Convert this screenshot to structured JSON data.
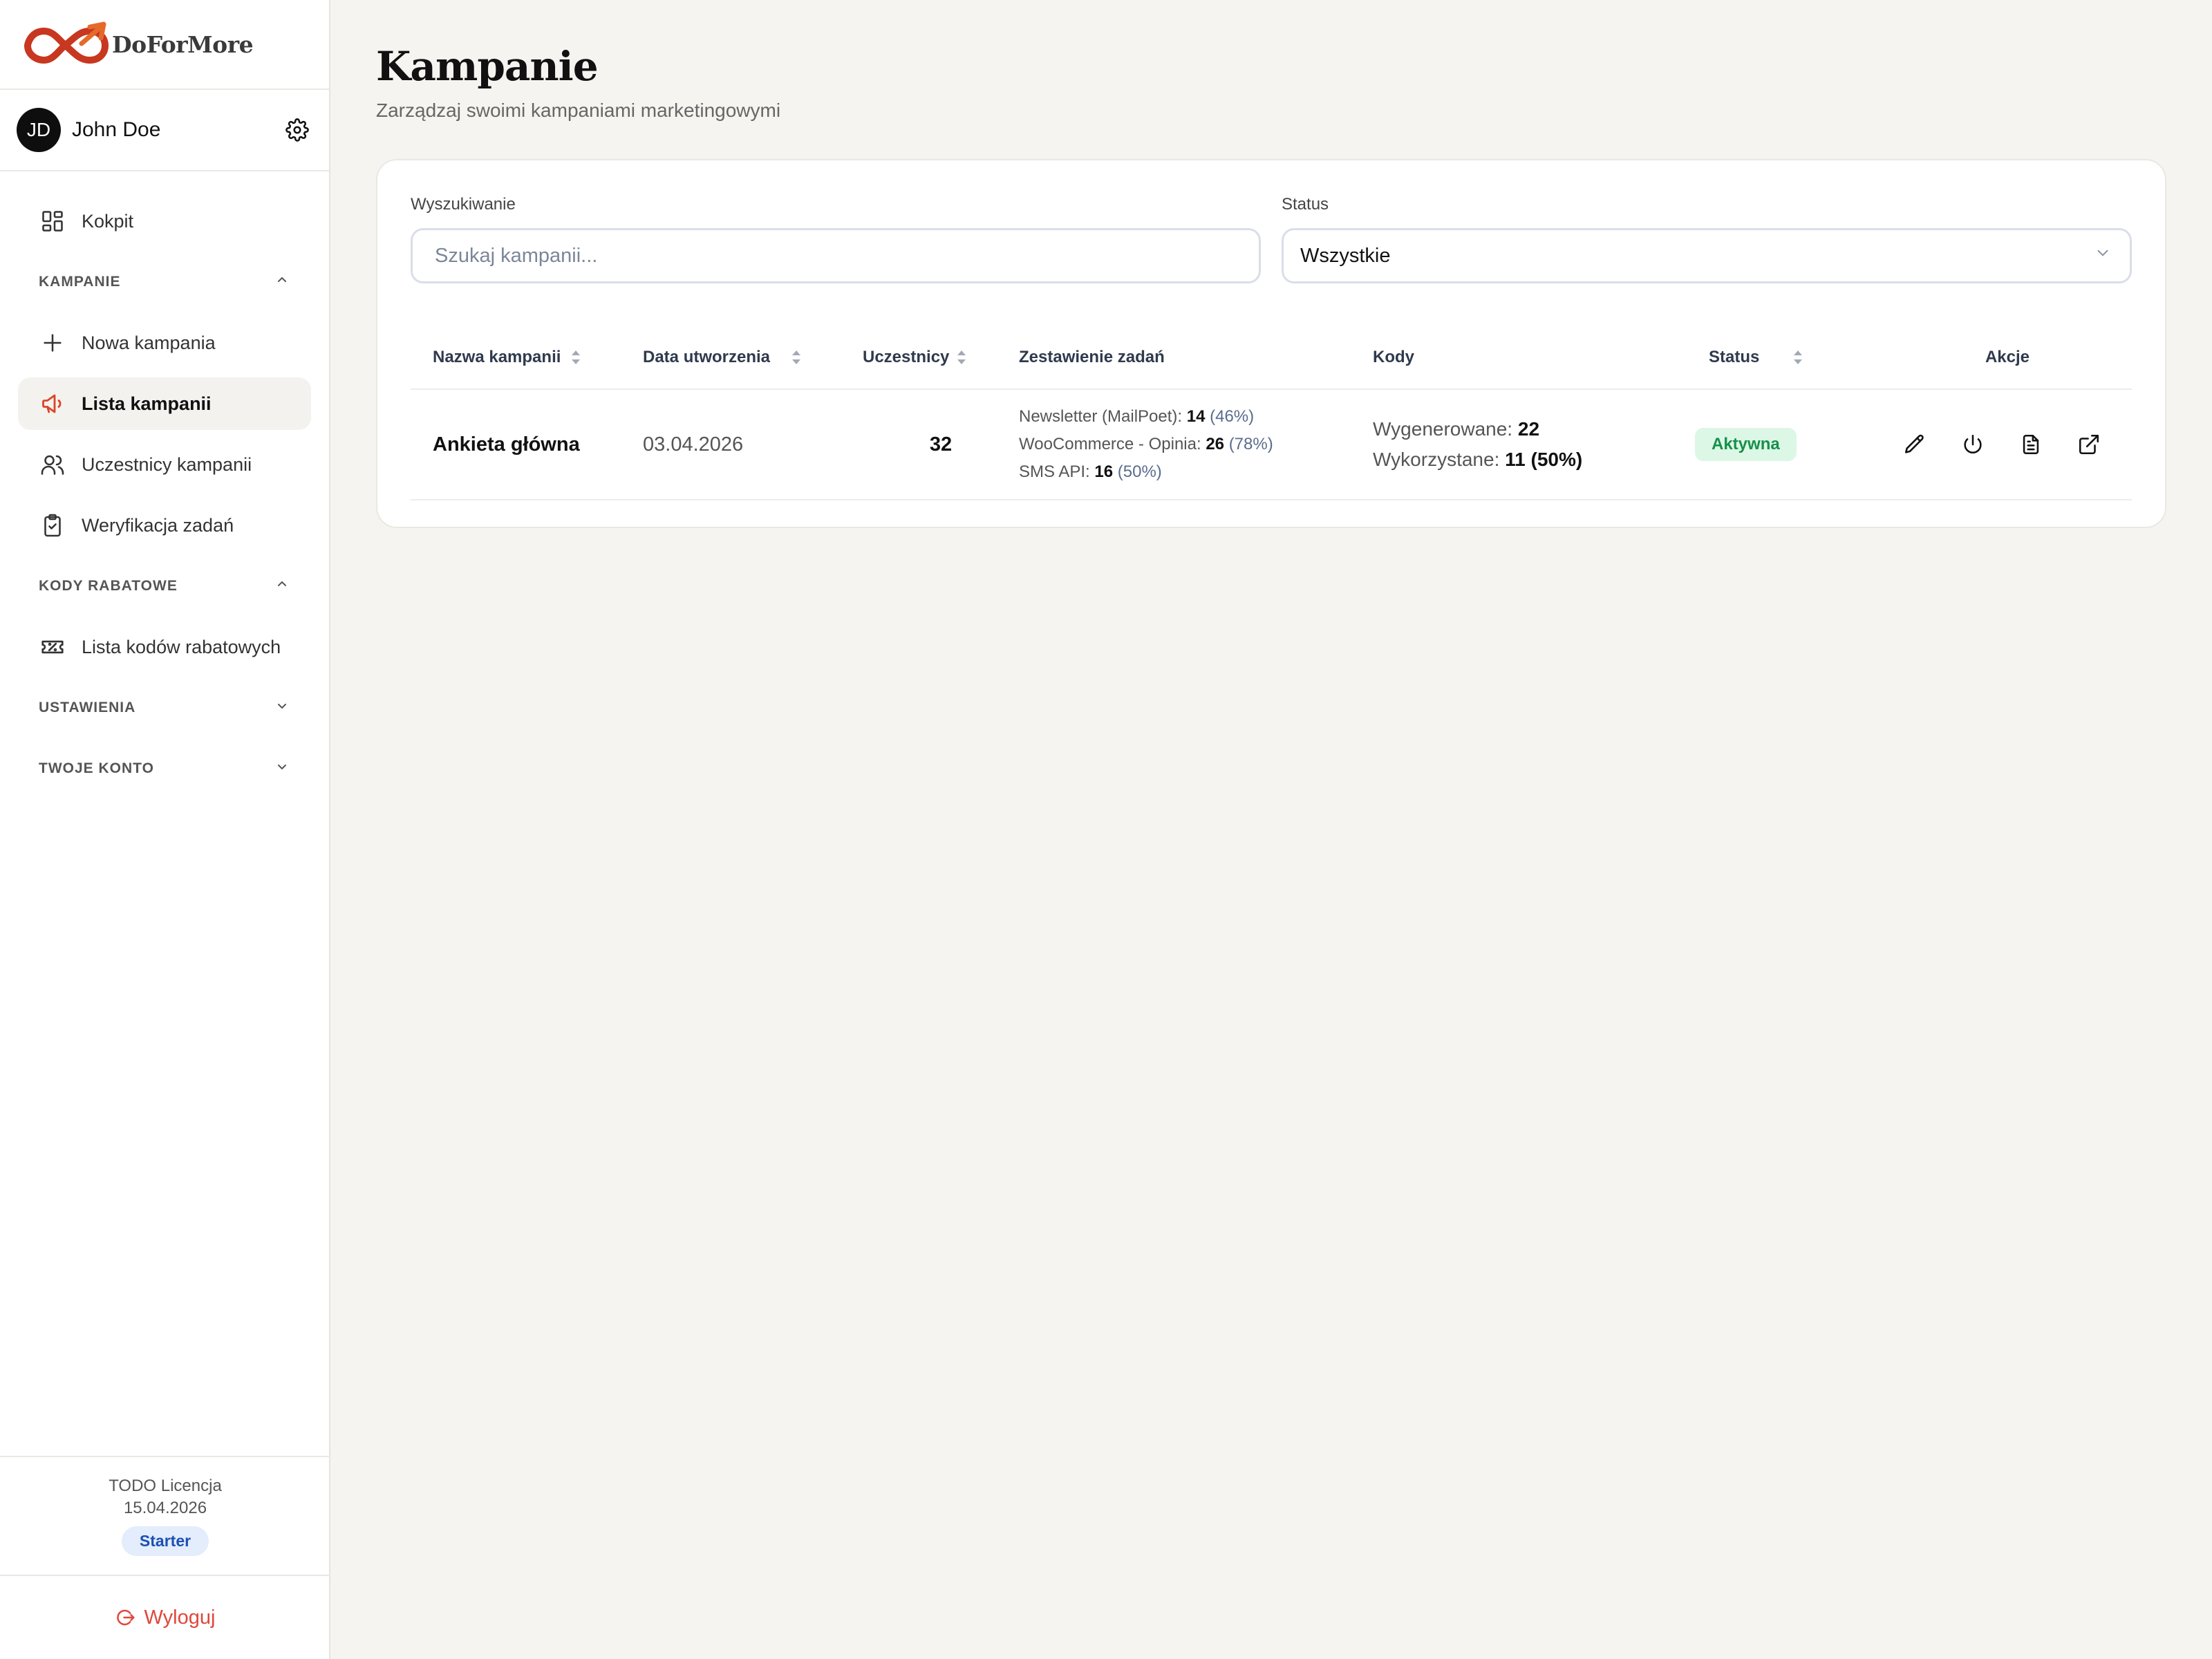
{
  "brand": {
    "name": "DoForMore",
    "accent": "#d9462a"
  },
  "user": {
    "initials": "JD",
    "name": "John Doe"
  },
  "nav": {
    "dashboard": "Kokpit",
    "sections": {
      "campaigns": "KAMPANIE",
      "codes": "KODY RABATOWE",
      "settings": "USTAWIENIA",
      "account": "TWOJE KONTO"
    },
    "new_campaign": "Nowa kampania",
    "campaign_list": "Lista kampanii",
    "participants": "Uczestnicy kampanii",
    "task_verification": "Weryfikacja zadań",
    "discount_codes": "Lista kodów rabatowych"
  },
  "license": {
    "label": "TODO Licencja",
    "date": "15.04.2026",
    "plan": "Starter"
  },
  "logout": "Wyloguj",
  "page": {
    "title": "Kampanie",
    "subtitle": "Zarządzaj swoimi kampaniami marketingowymi"
  },
  "filters": {
    "search_label": "Wyszukiwanie",
    "search_placeholder": "Szukaj kampanii...",
    "status_label": "Status",
    "status_value": "Wszystkie"
  },
  "table": {
    "headers": {
      "name": "Nazwa kampanii",
      "date": "Data utworzenia",
      "participants": "Uczestnicy",
      "tasks": "Zestawienie zadań",
      "codes": "Kody",
      "status": "Status",
      "actions": "Akcje"
    },
    "rows": [
      {
        "name": "Ankieta główna",
        "date": "03.04.2026",
        "participants": "32",
        "tasks": [
          {
            "label": "Newsletter (MailPoet):",
            "count": "14",
            "pct": "(46%)"
          },
          {
            "label": "WooCommerce - Opinia:",
            "count": "26",
            "pct": "(78%)"
          },
          {
            "label": "SMS API:",
            "count": "16",
            "pct": "(50%)"
          }
        ],
        "codes": {
          "generated_label": "Wygenerowane:",
          "generated": "22",
          "used_label": "Wykorzystane:",
          "used": "11 (50%)"
        },
        "status": "Aktywna",
        "status_color": "#17904a"
      }
    ]
  }
}
